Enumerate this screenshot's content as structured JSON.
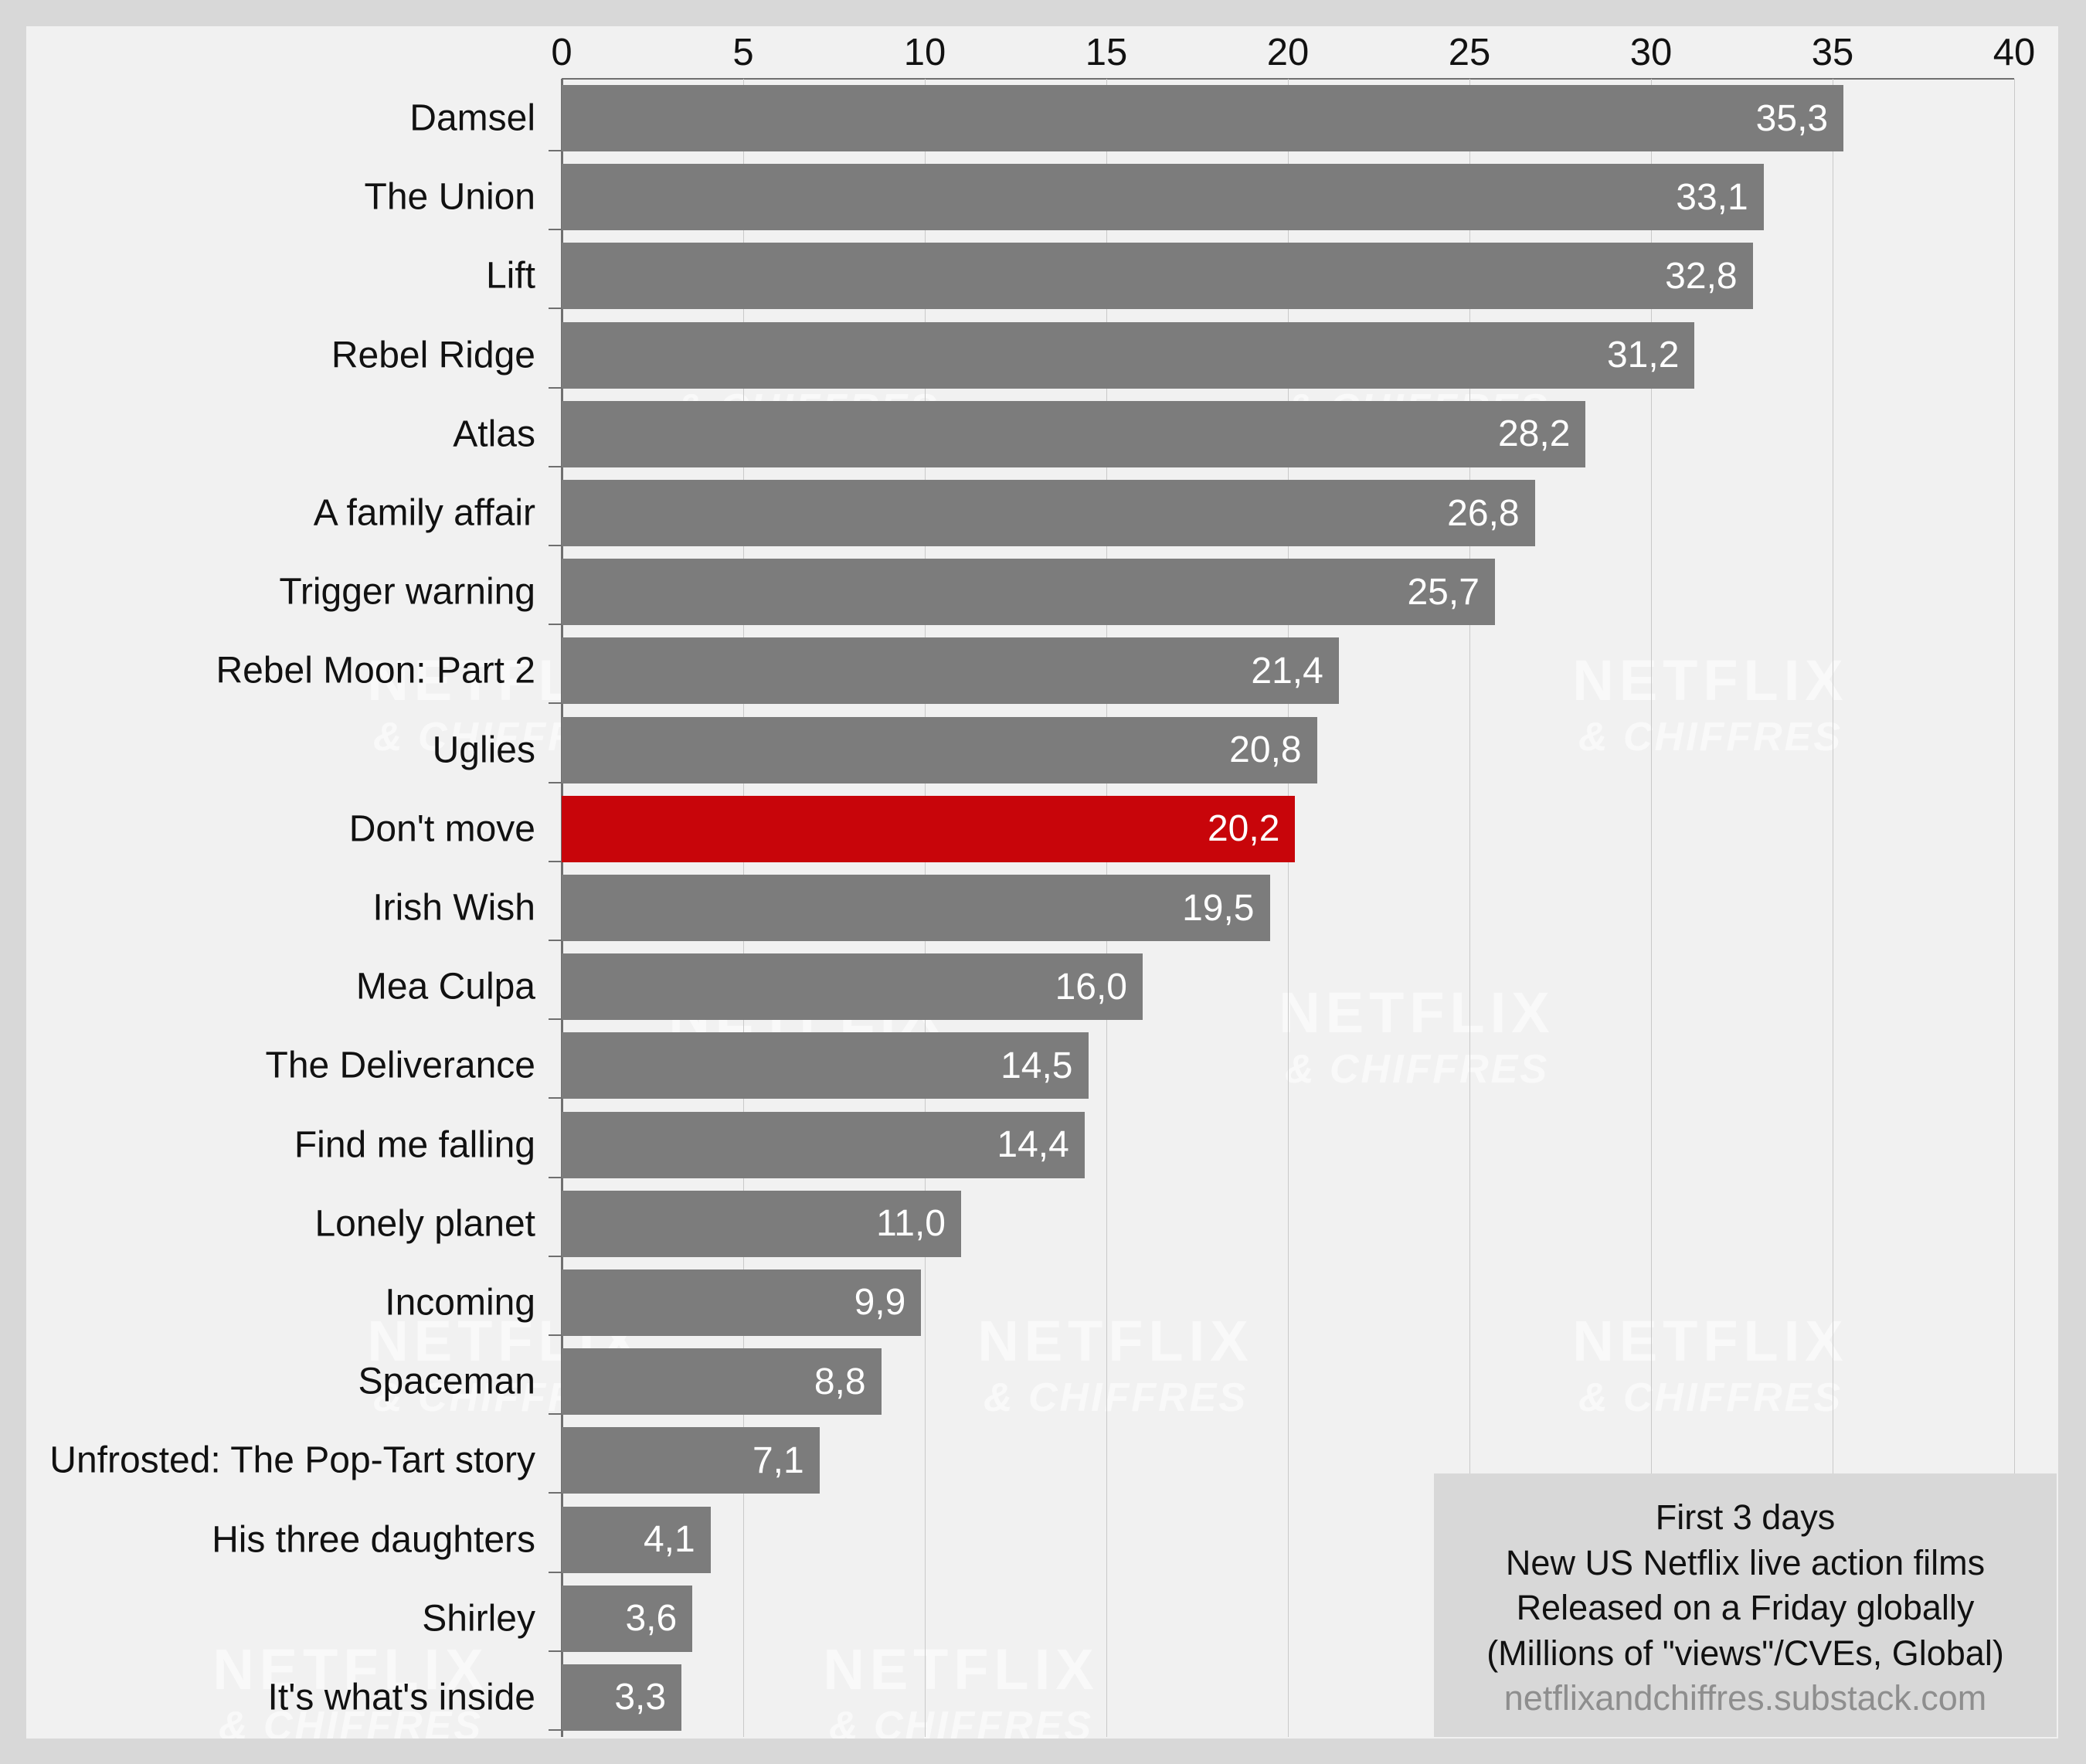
{
  "chart_data": {
    "type": "bar",
    "orientation": "horizontal",
    "title": "",
    "xlabel": "",
    "ylabel": "",
    "xlim": [
      0,
      40
    ],
    "xticks": [
      0,
      5,
      10,
      15,
      20,
      25,
      30,
      35,
      40
    ],
    "xtick_labels": [
      "0",
      "5",
      "10",
      "15",
      "20",
      "25",
      "30",
      "35",
      "40"
    ],
    "grid": true,
    "grid_axis": "x",
    "legend": false,
    "decimal_separator": ",",
    "categories": [
      "Damsel",
      "The Union",
      "Lift",
      "Rebel Ridge",
      "Atlas",
      "A family affair",
      "Trigger warning",
      "Rebel Moon: Part 2",
      "Uglies",
      "Don't move",
      "Irish Wish",
      "Mea Culpa",
      "The Deliverance",
      "Find me falling",
      "Lonely planet",
      "Incoming",
      "Spaceman",
      "Unfrosted: The Pop-Tart story",
      "His three daughters",
      "Shirley",
      "It's what's inside"
    ],
    "values": [
      35.3,
      33.1,
      32.8,
      31.2,
      28.2,
      26.8,
      25.7,
      21.4,
      20.8,
      20.2,
      19.5,
      16.0,
      14.5,
      14.4,
      11.0,
      9.9,
      8.8,
      7.1,
      4.1,
      3.6,
      3.3
    ],
    "value_labels": [
      "35,3",
      "33,1",
      "32,8",
      "31,2",
      "28,2",
      "26,8",
      "25,7",
      "21,4",
      "20,8",
      "20,2",
      "19,5",
      "16,0",
      "14,5",
      "14,4",
      "11,0",
      "9,9",
      "8,8",
      "7,1",
      "4,1",
      "3,6",
      "3,3"
    ],
    "highlighted": [
      "Don't move"
    ],
    "colors": {
      "bar": "#7c7c7c",
      "bar_highlight": "#c8050a",
      "value_label": "#ffffff",
      "canvas": "#f1f1f1",
      "figure": "#d8d8d8",
      "gridline": "#c9c9c9",
      "axis": "#6f6f6f",
      "text": "#111111",
      "url_text": "#8e8e8e"
    }
  },
  "caption": {
    "lines": [
      "First 3 days",
      "New US Netflix live action films",
      "Released on a Friday globally",
      "(Millions of \"views\"/CVEs, Global)"
    ],
    "url": "netflixandchiffres.substack.com"
  },
  "watermark": {
    "main": "NETFLIX",
    "sub": "& CHIFFRES"
  }
}
